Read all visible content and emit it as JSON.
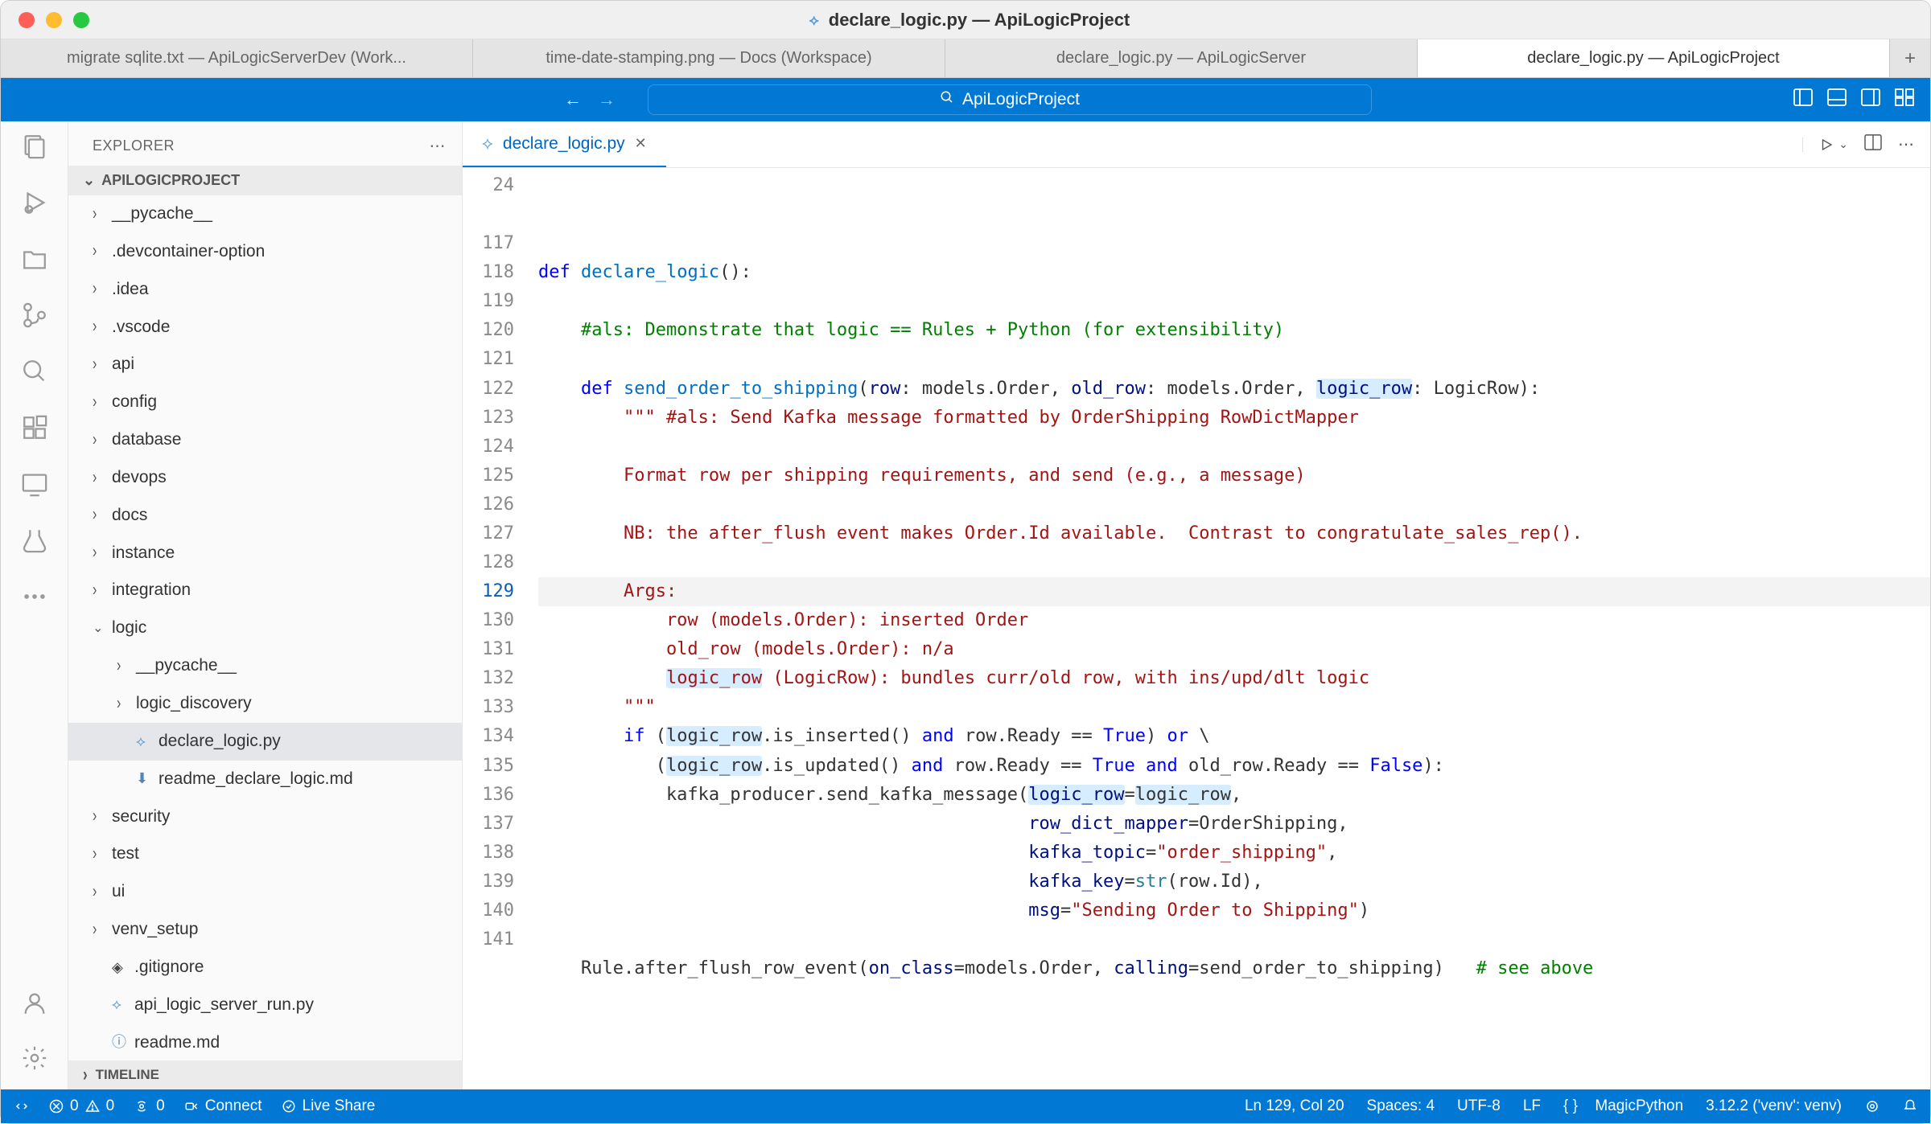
{
  "title": "declare_logic.py — ApiLogicProject",
  "windowTabs": [
    {
      "label": "migrate sqlite.txt — ApiLogicServerDev (Work...",
      "active": false
    },
    {
      "label": "time-date-stamping.png — Docs (Workspace)",
      "active": false
    },
    {
      "label": "declare_logic.py — ApiLogicServer",
      "active": false
    },
    {
      "label": "declare_logic.py — ApiLogicProject",
      "active": true
    }
  ],
  "searchCenter": "ApiLogicProject",
  "explorer": {
    "title": "EXPLORER",
    "project": "APILOGICPROJECT",
    "items": [
      {
        "label": "__pycache__",
        "type": "folder",
        "indent": 0
      },
      {
        "label": ".devcontainer-option",
        "type": "folder",
        "indent": 0
      },
      {
        "label": ".idea",
        "type": "folder",
        "indent": 0
      },
      {
        "label": ".vscode",
        "type": "folder",
        "indent": 0
      },
      {
        "label": "api",
        "type": "folder",
        "indent": 0
      },
      {
        "label": "config",
        "type": "folder",
        "indent": 0
      },
      {
        "label": "database",
        "type": "folder",
        "indent": 0
      },
      {
        "label": "devops",
        "type": "folder",
        "indent": 0
      },
      {
        "label": "docs",
        "type": "folder",
        "indent": 0
      },
      {
        "label": "instance",
        "type": "folder",
        "indent": 0
      },
      {
        "label": "integration",
        "type": "folder",
        "indent": 0
      },
      {
        "label": "logic",
        "type": "folder-open",
        "indent": 0
      },
      {
        "label": "__pycache__",
        "type": "folder",
        "indent": 1
      },
      {
        "label": "logic_discovery",
        "type": "folder",
        "indent": 1
      },
      {
        "label": "declare_logic.py",
        "type": "python",
        "indent": 1,
        "selected": true
      },
      {
        "label": "readme_declare_logic.md",
        "type": "md",
        "indent": 1
      },
      {
        "label": "security",
        "type": "folder",
        "indent": 0
      },
      {
        "label": "test",
        "type": "folder",
        "indent": 0
      },
      {
        "label": "ui",
        "type": "folder",
        "indent": 0
      },
      {
        "label": "venv_setup",
        "type": "folder",
        "indent": 0
      },
      {
        "label": ".gitignore",
        "type": "git",
        "indent": 0
      },
      {
        "label": "api_logic_server_run.py",
        "type": "python",
        "indent": 0
      },
      {
        "label": "readme.md",
        "type": "info",
        "indent": 0
      }
    ],
    "timeline": "TIMELINE"
  },
  "editor": {
    "tab": "declare_logic.py",
    "lineNumbers": [
      "24",
      "",
      "117",
      "118",
      "119",
      "120",
      "121",
      "122",
      "123",
      "124",
      "125",
      "126",
      "127",
      "128",
      "129",
      "130",
      "131",
      "132",
      "133",
      "134",
      "135",
      "136",
      "137",
      "138",
      "139",
      "140",
      "141"
    ],
    "activeLine": "129"
  },
  "code": {
    "l24_def": "def",
    "l24_fn": " declare_logic",
    "l24_end": "():",
    "l117": "    #als: Demonstrate that logic == Rules + Python (for extensibility)",
    "l119_def": "    def",
    "l119_fn": " send_order_to_shipping",
    "l119_p1": "row",
    "l119_t1": ": models.Order, ",
    "l119_p2": "old_row",
    "l119_t2": ": models.Order, ",
    "l119_p3": "logic_row",
    "l119_t3": ": LogicRow):",
    "l120": "        \"\"\" #als: Send Kafka message formatted by OrderShipping RowDictMapper",
    "l122": "        Format row per shipping requirements, and send (e.g., a message)",
    "l124": "        NB: the after_flush event makes Order.Id available.  Contrast to congratulate_sales_rep().",
    "l126": "        Args:",
    "l127": "            row (models.Order): inserted Order",
    "l128": "            old_row (models.Order): n/a",
    "l129a": "            ",
    "l129b": "logic_row",
    "l129c": " (LogicRow): bundles curr/old row, with ins/upd/dlt logic",
    "l130": "        \"\"\"",
    "l131_if": "        if",
    "l131_a": " (",
    "l131_lr": "logic_row",
    "l131_b": ".is_inserted() ",
    "l131_and": "and",
    "l131_c": " row.Ready == ",
    "l131_true": "True",
    "l131_d": ") ",
    "l131_or": "or",
    "l131_e": " \\",
    "l132_a": "           (",
    "l132_lr": "logic_row",
    "l132_b": ".is_updated() ",
    "l132_and": "and",
    "l132_c": " row.Ready == ",
    "l132_true": "True",
    "l132_d": " ",
    "l132_and2": "and",
    "l132_e": " old_row.Ready == ",
    "l132_false": "False",
    "l132_f": "):",
    "l133_a": "            kafka_producer.send_kafka_message(",
    "l133_lr1": "logic_row",
    "l133_eq": "=",
    "l133_lr2": "logic_row",
    "l133_end": ",",
    "l134_a": "                                              ",
    "l134_b": "row_dict_mapper",
    "l134_c": "=OrderShipping,",
    "l135_a": "                                              ",
    "l135_b": "kafka_topic",
    "l135_c": "=",
    "l135_str": "\"order_shipping\"",
    "l135_d": ",",
    "l136_a": "                                              ",
    "l136_b": "kafka_key",
    "l136_c": "=",
    "l136_d": "str",
    "l136_e": "(row.Id),",
    "l137_a": "                                              ",
    "l137_b": "msg",
    "l137_c": "=",
    "l137_str": "\"Sending Order to Shipping\"",
    "l137_d": ")",
    "l139_a": "    Rule.after_flush_row_event(",
    "l139_p1": "on_class",
    "l139_b": "=models.Order, ",
    "l139_p2": "calling",
    "l139_c": "=send_order_to_shipping)",
    "l139_com": "   # see above"
  },
  "status": {
    "errors": "0",
    "warnings": "0",
    "ports": "0",
    "connect": "Connect",
    "liveShare": "Live Share",
    "position": "Ln 129, Col 20",
    "spaces": "Spaces: 4",
    "encoding": "UTF-8",
    "eol": "LF",
    "language": "MagicPython",
    "python": "3.12.2 ('venv': venv)"
  }
}
